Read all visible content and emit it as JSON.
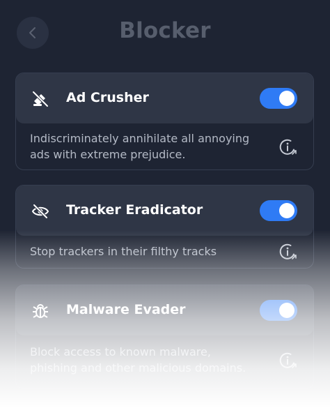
{
  "header": {
    "back_icon": "chevron-left-icon",
    "title": "Blocker"
  },
  "colors": {
    "background": "#1e2433",
    "card_header": "#2f3646",
    "toggle_on": "#2f7bf5",
    "title_text": "#575e6d"
  },
  "features": [
    {
      "icon": "ad-block-icon",
      "title": "Ad Crusher",
      "enabled": true,
      "description": "Indiscriminately annihilate all annoying ads with extreme prejudice.",
      "info_icon": "info-link-icon"
    },
    {
      "icon": "eye-slash-icon",
      "title": "Tracker Eradicator",
      "enabled": true,
      "description": "Stop trackers in their filthy tracks",
      "info_icon": "info-link-icon"
    },
    {
      "icon": "bug-icon",
      "title": "Malware Evader",
      "enabled": true,
      "description": "Block access to known malware, phishing and other malicious domains.",
      "info_icon": "info-link-icon"
    }
  ]
}
